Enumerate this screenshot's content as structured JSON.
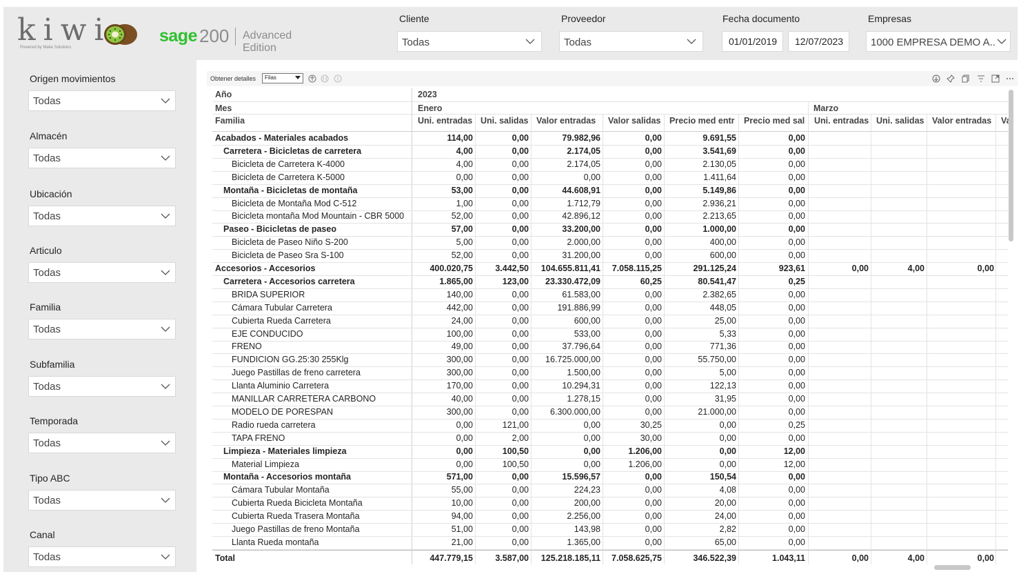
{
  "brand": {
    "kiwi": "kiwi",
    "kiwi_sub": "Powered by Make Solutions",
    "sage": "sage",
    "sage_version": "200",
    "edition": "Advanced Edition"
  },
  "top_filters": {
    "cliente": {
      "label": "Cliente",
      "value": "Todas"
    },
    "proveedor": {
      "label": "Proveedor",
      "value": "Todas"
    },
    "fecha": {
      "label": "Fecha documento",
      "from": "01/01/2019",
      "to": "12/07/2023"
    },
    "empresas": {
      "label": "Empresas",
      "value": "1000 EMPRESA DEMO A..."
    }
  },
  "side_filters": [
    {
      "label": "Origen movimientos",
      "value": "Todas"
    },
    {
      "label": "Almacén",
      "value": "Todas"
    },
    {
      "label": "Ubicación",
      "value": "Todas"
    },
    {
      "label": "Articulo",
      "value": "Todas"
    },
    {
      "label": "Familia",
      "value": "Todas"
    },
    {
      "label": "Subfamilia",
      "value": "Todas"
    },
    {
      "label": "Temporada",
      "value": "Todas"
    },
    {
      "label": "Tipo ABC",
      "value": "Todas"
    },
    {
      "label": "Canal",
      "value": "Todas"
    }
  ],
  "visual_header": {
    "details_label": "Obtener detalles",
    "details_value": "Filas"
  },
  "matrix": {
    "row_headers": {
      "year": "Año",
      "month": "Mes",
      "family": "Familia"
    },
    "year": "2023",
    "months": [
      "Enero",
      "Marzo"
    ],
    "columns": [
      "Uni. entradas",
      "Uni. salidas",
      "Valor entradas",
      "Valor salidas",
      "Precio med entr",
      "Precio med sal",
      "Uni. entradas",
      "Uni. salidas",
      "Valor entradas",
      "Va"
    ],
    "rows": [
      {
        "label": "Acabados - Materiales acabados",
        "level": 0,
        "bold": true,
        "values": [
          "114,00",
          "0,00",
          "79.982,96",
          "0,00",
          "9.691,55",
          "0,00",
          "",
          "",
          ""
        ]
      },
      {
        "label": "Carretera - Bicicletas de carretera",
        "level": 1,
        "bold": true,
        "values": [
          "4,00",
          "0,00",
          "2.174,05",
          "0,00",
          "3.541,69",
          "0,00",
          "",
          "",
          ""
        ]
      },
      {
        "label": "Bicicleta de Carretera K-4000",
        "level": 2,
        "bold": false,
        "values": [
          "4,00",
          "0,00",
          "2.174,05",
          "0,00",
          "2.130,05",
          "0,00",
          "",
          "",
          ""
        ]
      },
      {
        "label": "Bicicleta de Carretera K-5000",
        "level": 2,
        "bold": false,
        "values": [
          "0,00",
          "0,00",
          "0,00",
          "0,00",
          "1.411,64",
          "0,00",
          "",
          "",
          ""
        ]
      },
      {
        "label": "Montaña - Bicicletas de montaña",
        "level": 1,
        "bold": true,
        "values": [
          "53,00",
          "0,00",
          "44.608,91",
          "0,00",
          "5.149,86",
          "0,00",
          "",
          "",
          ""
        ]
      },
      {
        "label": "Bicicleta de Montaña Mod C-512",
        "level": 2,
        "bold": false,
        "values": [
          "1,00",
          "0,00",
          "1.712,79",
          "0,00",
          "2.936,21",
          "0,00",
          "",
          "",
          ""
        ]
      },
      {
        "label": "Bicicleta montaña Mod Mountain - CBR 5000",
        "level": 2,
        "bold": false,
        "values": [
          "52,00",
          "0,00",
          "42.896,12",
          "0,00",
          "2.213,65",
          "0,00",
          "",
          "",
          ""
        ]
      },
      {
        "label": "Paseo - Bicicletas de paseo",
        "level": 1,
        "bold": true,
        "values": [
          "57,00",
          "0,00",
          "33.200,00",
          "0,00",
          "1.000,00",
          "0,00",
          "",
          "",
          ""
        ]
      },
      {
        "label": "Bicicleta de Paseo Niño S-200",
        "level": 2,
        "bold": false,
        "values": [
          "5,00",
          "0,00",
          "2.000,00",
          "0,00",
          "400,00",
          "0,00",
          "",
          "",
          ""
        ]
      },
      {
        "label": "Bicicleta de Paseo Sra S-100",
        "level": 2,
        "bold": false,
        "values": [
          "52,00",
          "0,00",
          "31.200,00",
          "0,00",
          "600,00",
          "0,00",
          "",
          "",
          ""
        ]
      },
      {
        "label": "Accesorios - Accesorios",
        "level": 0,
        "bold": true,
        "values": [
          "400.020,75",
          "3.442,50",
          "104.655.811,41",
          "7.058.115,25",
          "291.125,24",
          "923,61",
          "0,00",
          "4,00",
          "0,00"
        ]
      },
      {
        "label": "Carretera - Accesorios carretera",
        "level": 1,
        "bold": true,
        "values": [
          "1.865,00",
          "123,00",
          "23.330.472,09",
          "60,25",
          "80.541,47",
          "0,25",
          "",
          "",
          ""
        ]
      },
      {
        "label": "BRIDA SUPERIOR",
        "level": 2,
        "bold": false,
        "values": [
          "140,00",
          "0,00",
          "61.583,00",
          "0,00",
          "2.382,65",
          "0,00",
          "",
          "",
          ""
        ]
      },
      {
        "label": "Cámara Tubular Carretera",
        "level": 2,
        "bold": false,
        "values": [
          "442,00",
          "0,00",
          "191.886,99",
          "0,00",
          "448,05",
          "0,00",
          "",
          "",
          ""
        ]
      },
      {
        "label": "Cubierta Rueda Carretera",
        "level": 2,
        "bold": false,
        "values": [
          "24,00",
          "0,00",
          "600,00",
          "0,00",
          "25,00",
          "0,00",
          "",
          "",
          ""
        ]
      },
      {
        "label": "EJE CONDUCIDO",
        "level": 2,
        "bold": false,
        "values": [
          "100,00",
          "0,00",
          "533,00",
          "0,00",
          "5,33",
          "0,00",
          "",
          "",
          ""
        ]
      },
      {
        "label": "FRENO",
        "level": 2,
        "bold": false,
        "values": [
          "49,00",
          "0,00",
          "37.796,64",
          "0,00",
          "771,36",
          "0,00",
          "",
          "",
          ""
        ]
      },
      {
        "label": "FUNDICION GG.25:30 255Klg",
        "level": 2,
        "bold": false,
        "values": [
          "300,00",
          "0,00",
          "16.725.000,00",
          "0,00",
          "55.750,00",
          "0,00",
          "",
          "",
          ""
        ]
      },
      {
        "label": "Juego Pastillas de freno carretera",
        "level": 2,
        "bold": false,
        "values": [
          "300,00",
          "0,00",
          "1.500,00",
          "0,00",
          "5,00",
          "0,00",
          "",
          "",
          ""
        ]
      },
      {
        "label": "Llanta Aluminio Carretera",
        "level": 2,
        "bold": false,
        "values": [
          "170,00",
          "0,00",
          "10.294,31",
          "0,00",
          "122,13",
          "0,00",
          "",
          "",
          ""
        ]
      },
      {
        "label": "MANILLAR CARRETERA CARBONO",
        "level": 2,
        "bold": false,
        "values": [
          "40,00",
          "0,00",
          "1.278,15",
          "0,00",
          "31,95",
          "0,00",
          "",
          "",
          ""
        ]
      },
      {
        "label": "MODELO DE PORESPAN",
        "level": 2,
        "bold": false,
        "values": [
          "300,00",
          "0,00",
          "6.300.000,00",
          "0,00",
          "21.000,00",
          "0,00",
          "",
          "",
          ""
        ]
      },
      {
        "label": "Radio rueda carretera",
        "level": 2,
        "bold": false,
        "values": [
          "0,00",
          "121,00",
          "0,00",
          "30,25",
          "0,00",
          "0,25",
          "",
          "",
          ""
        ]
      },
      {
        "label": "TAPA FRENO",
        "level": 2,
        "bold": false,
        "values": [
          "0,00",
          "2,00",
          "0,00",
          "30,00",
          "0,00",
          "0,00",
          "",
          "",
          ""
        ]
      },
      {
        "label": "Limpieza - Materiales limpieza",
        "level": 1,
        "bold": true,
        "values": [
          "0,00",
          "100,50",
          "0,00",
          "1.206,00",
          "0,00",
          "12,00",
          "",
          "",
          ""
        ]
      },
      {
        "label": "Material Limpieza",
        "level": 2,
        "bold": false,
        "values": [
          "0,00",
          "100,50",
          "0,00",
          "1.206,00",
          "0,00",
          "12,00",
          "",
          "",
          ""
        ]
      },
      {
        "label": "Montaña - Accesorios montaña",
        "level": 1,
        "bold": true,
        "values": [
          "571,00",
          "0,00",
          "15.596,57",
          "0,00",
          "150,54",
          "0,00",
          "",
          "",
          ""
        ]
      },
      {
        "label": "Cámara Tubular Montaña",
        "level": 2,
        "bold": false,
        "values": [
          "55,00",
          "0,00",
          "224,23",
          "0,00",
          "4,08",
          "0,00",
          "",
          "",
          ""
        ]
      },
      {
        "label": "Cubierta Rueda Bicicleta Montaña",
        "level": 2,
        "bold": false,
        "values": [
          "10,00",
          "0,00",
          "200,00",
          "0,00",
          "20,00",
          "0,00",
          "",
          "",
          ""
        ]
      },
      {
        "label": "Cubierta Rueda Trasera Montaña",
        "level": 2,
        "bold": false,
        "values": [
          "94,00",
          "0,00",
          "2.256,00",
          "0,00",
          "24,00",
          "0,00",
          "",
          "",
          ""
        ]
      },
      {
        "label": "Juego Pastillas de freno Montaña",
        "level": 2,
        "bold": false,
        "values": [
          "51,00",
          "0,00",
          "143,98",
          "0,00",
          "2,82",
          "0,00",
          "",
          "",
          ""
        ]
      },
      {
        "label": "Llanta Rueda montaña",
        "level": 2,
        "bold": false,
        "values": [
          "21,00",
          "0,00",
          "1.365,00",
          "0,00",
          "65,00",
          "0,00",
          "",
          "",
          ""
        ]
      }
    ],
    "total": {
      "label": "Total",
      "values": [
        "447.779,15",
        "3.587,00",
        "125.218.185,11",
        "7.058.625,75",
        "346.522,39",
        "1.043,11",
        "0,00",
        "4,00",
        "0,00"
      ]
    }
  }
}
